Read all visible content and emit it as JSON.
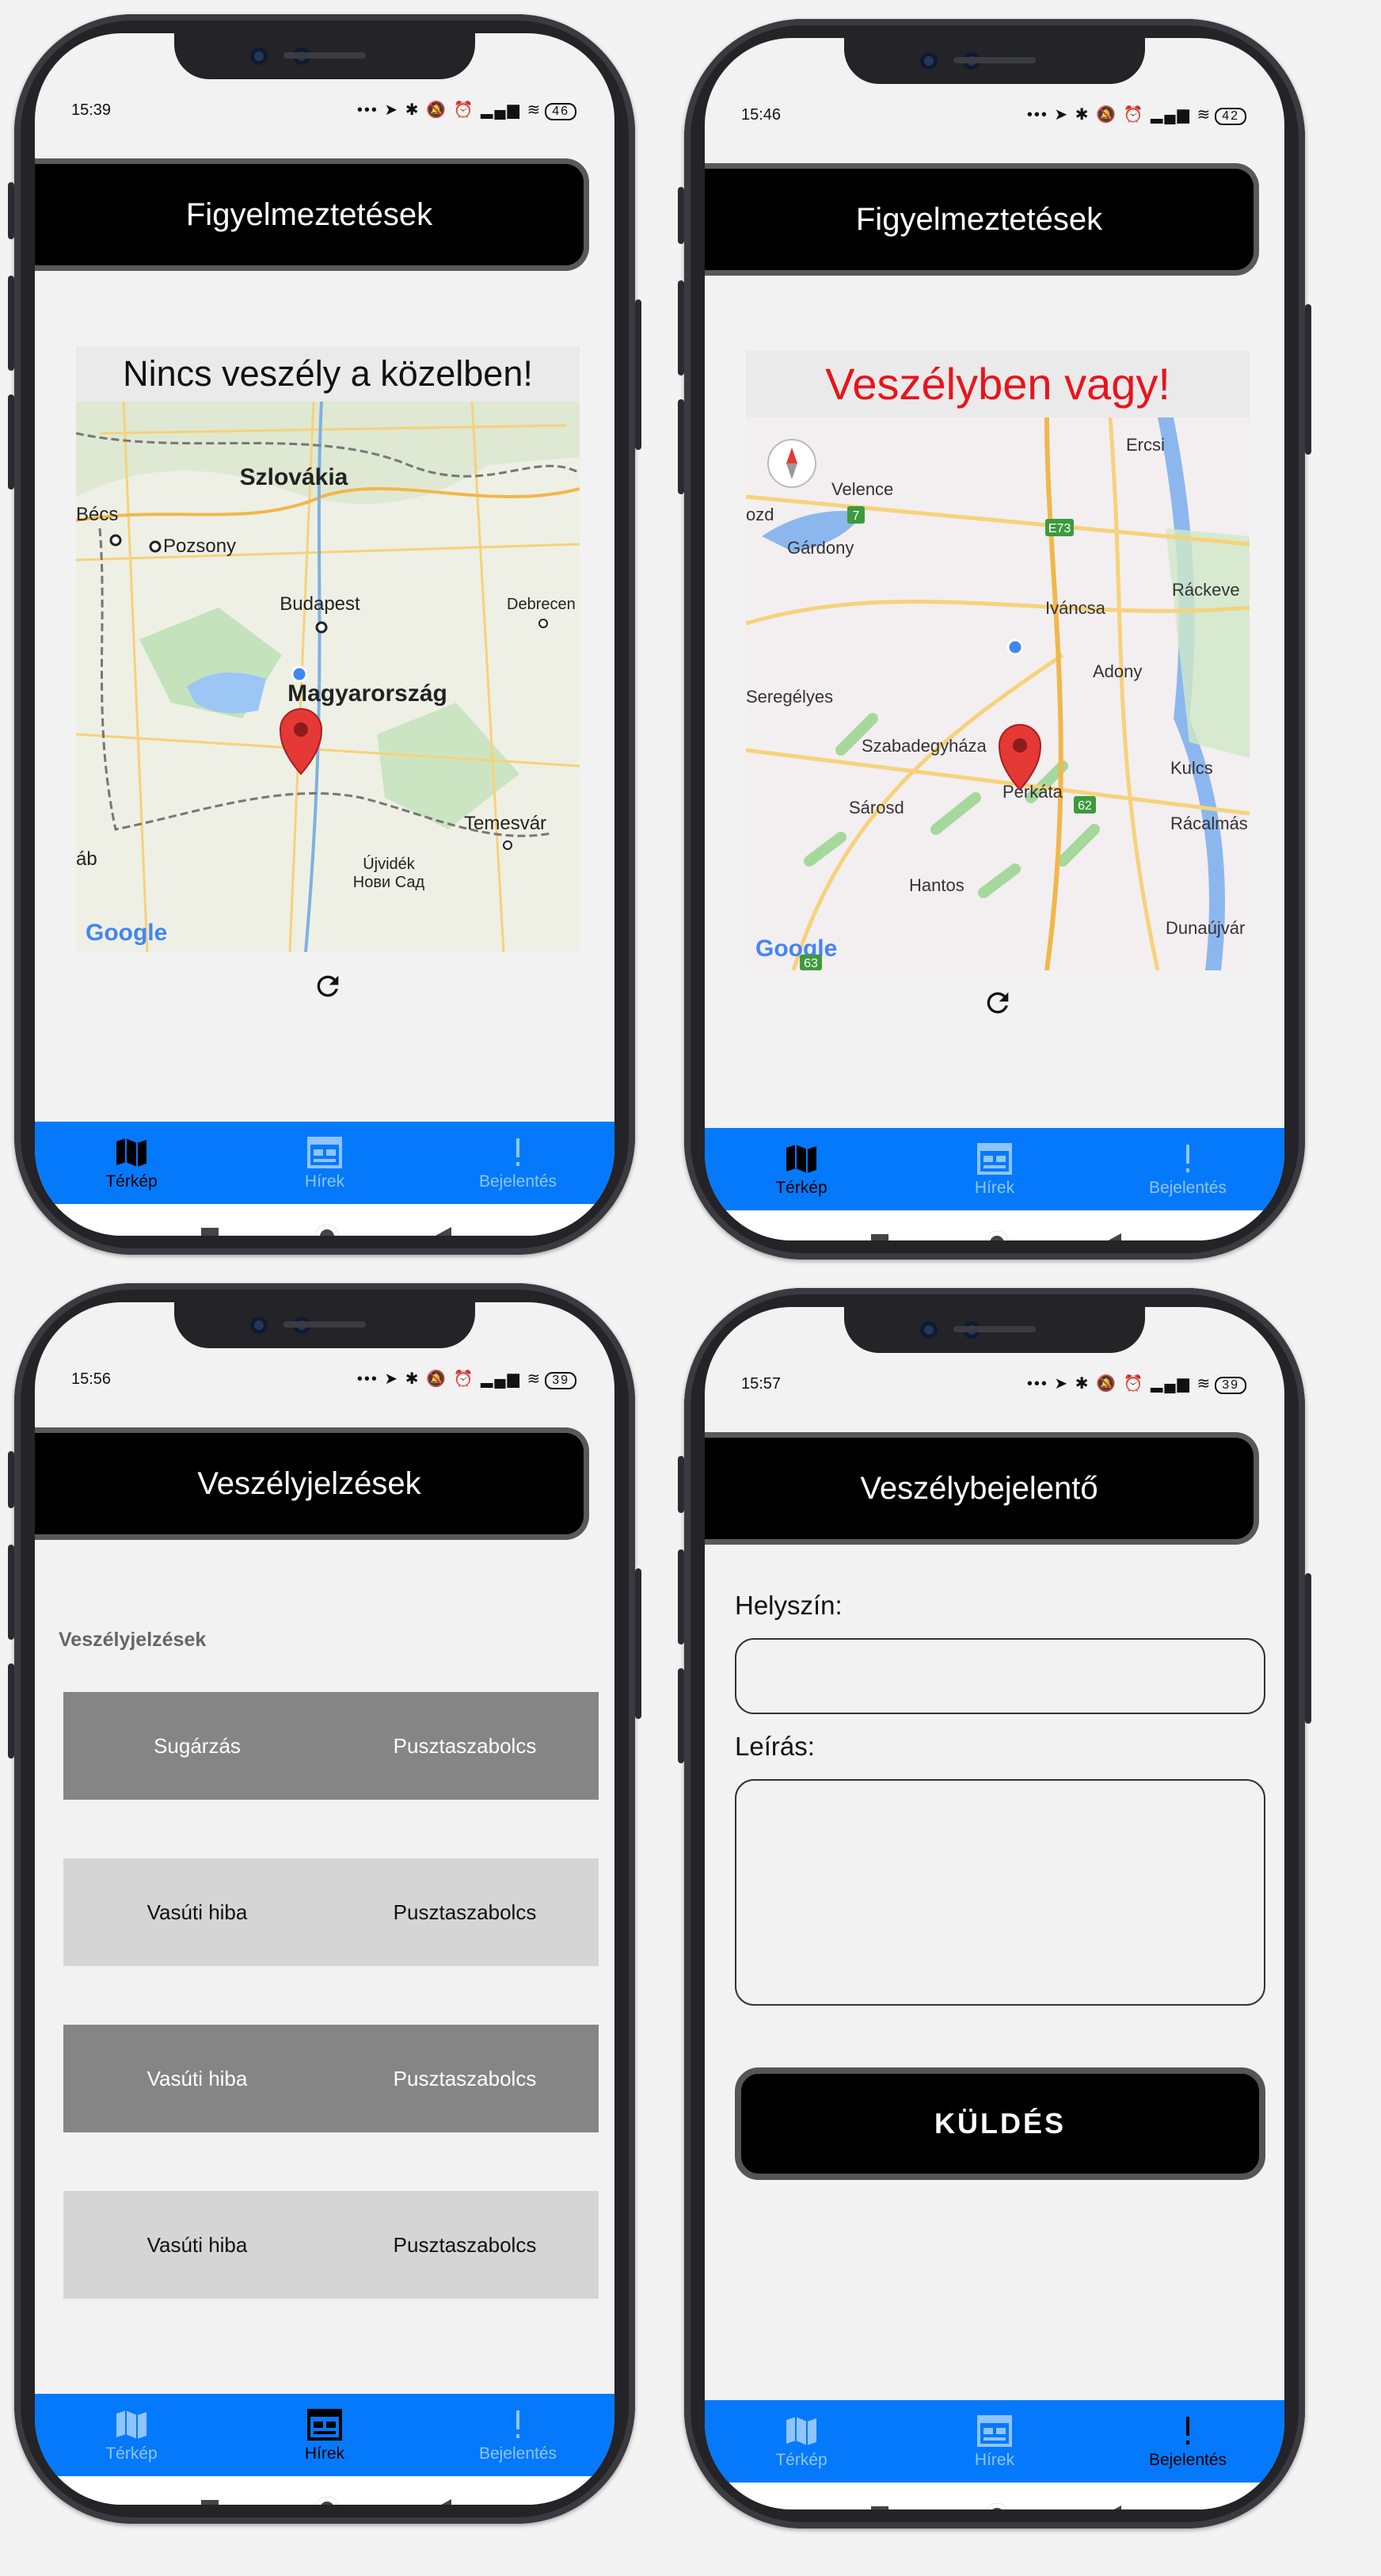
{
  "nav_labels": {
    "map": "Térkép",
    "news": "Hírek",
    "report": "Bejelentés"
  },
  "phones": [
    {
      "time": "15:39",
      "battery": "46",
      "header": "Figyelmeztetések",
      "message": "Nincs veszély a közelben!",
      "message_color": "#111111",
      "map_labels": [
        "Szlovákia",
        "Bécs",
        "Pozsony",
        "Budapest",
        "Debrecen",
        "Magyarország",
        "Temesvár",
        "Újvidék",
        "Нови Сад",
        "áb",
        "Google"
      ],
      "active_tab": "map"
    },
    {
      "time": "15:46",
      "battery": "42",
      "header": "Figyelmeztetések",
      "message": "Veszélyben vagy!",
      "message_color": "#e8141c",
      "map_labels": [
        "Ercsi",
        "Velence",
        "ozd",
        "Gárdony",
        "Ráckeve",
        "Iváncsa",
        "Adony",
        "Seregélyes",
        "Szabadegyháza",
        "Perkáta",
        "Kulcs",
        "Sárosd",
        "Rácalmás",
        "Hantos",
        "Dunaújvár",
        "Google",
        "E73",
        "7",
        "62",
        "63"
      ],
      "active_tab": "map"
    },
    {
      "time": "15:56",
      "battery": "39",
      "header": "Veszélyjelzések",
      "list_title": "Veszélyjelzések",
      "rows": [
        {
          "type": "Sugárzás",
          "place": "Pusztaszabolcs"
        },
        {
          "type": "Vasúti hiba",
          "place": "Pusztaszabolcs"
        },
        {
          "type": "Vasúti hiba",
          "place": "Pusztaszabolcs"
        },
        {
          "type": "Vasúti hiba",
          "place": "Pusztaszabolcs"
        }
      ],
      "active_tab": "news"
    },
    {
      "time": "15:57",
      "battery": "39",
      "header": "Veszélybejelentő",
      "location_label": "Helyszín:",
      "location_value": "",
      "description_label": "Leírás:",
      "description_value": "",
      "send_label": "KÜLDÉS",
      "active_tab": "report"
    }
  ],
  "colors": {
    "navbar": "#0579fb",
    "nav_active": "#000000",
    "nav_inactive": "#8fc4ff",
    "danger": "#e8141c"
  }
}
